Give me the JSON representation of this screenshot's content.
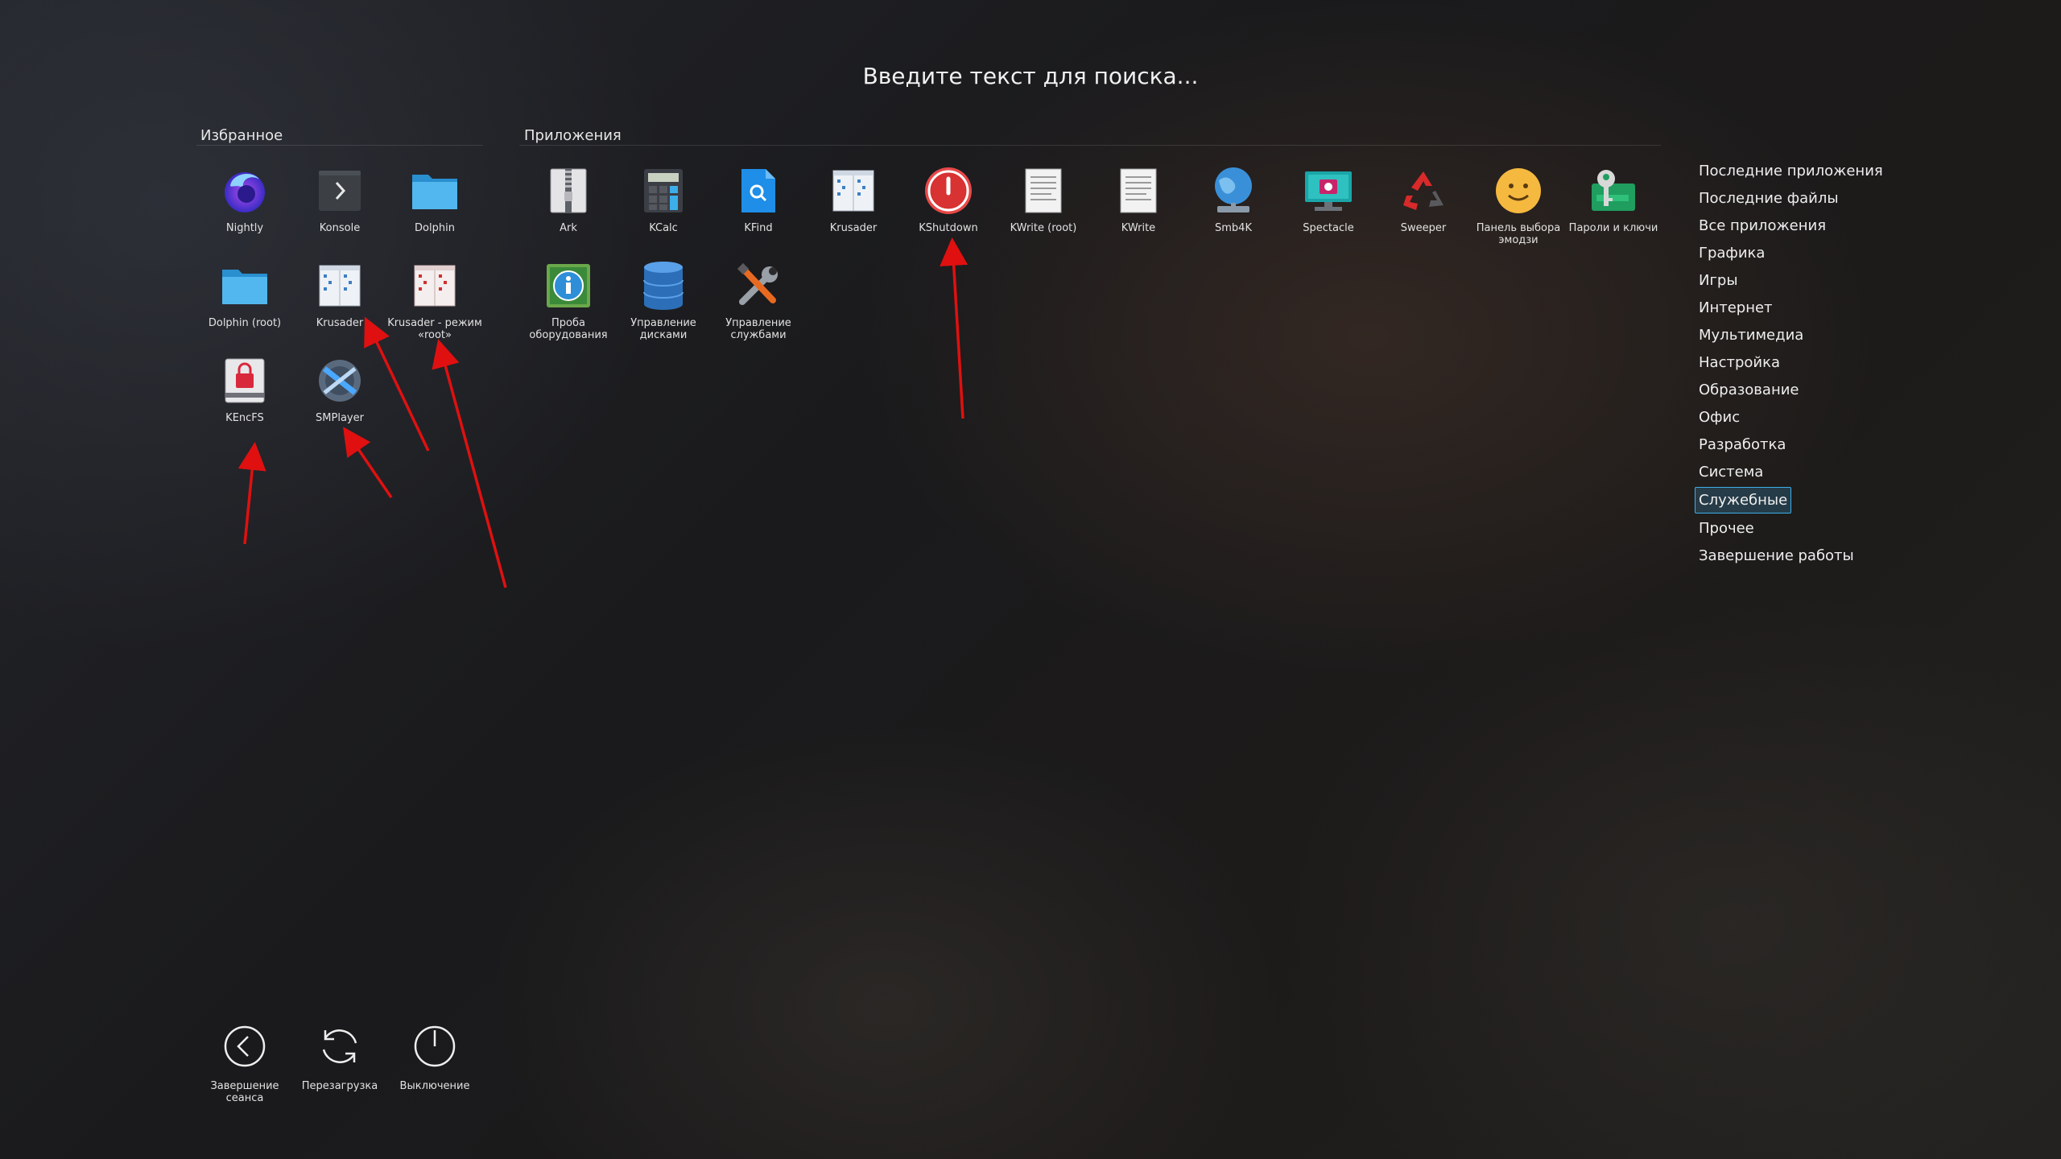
{
  "search": {
    "placeholder": "Введите текст для поиска..."
  },
  "favorites": {
    "title": "Избранное",
    "items": [
      {
        "label": "Nightly",
        "icon": "firefox-nightly-icon"
      },
      {
        "label": "Konsole",
        "icon": "konsole-icon"
      },
      {
        "label": "Dolphin",
        "icon": "dolphin-folder-icon"
      },
      {
        "label": "Dolphin (root)",
        "icon": "dolphin-folder-icon"
      },
      {
        "label": "Krusader",
        "icon": "krusader-icon"
      },
      {
        "label": "Krusader - режим «root»",
        "icon": "krusader-root-icon"
      },
      {
        "label": "KEncFS",
        "icon": "kencfs-lock-icon"
      },
      {
        "label": "SMPlayer",
        "icon": "smplayer-icon"
      }
    ]
  },
  "applications": {
    "title": "Приложения",
    "items": [
      {
        "label": "Ark",
        "icon": "ark-archive-icon"
      },
      {
        "label": "KCalc",
        "icon": "kcalc-icon"
      },
      {
        "label": "KFind",
        "icon": "kfind-icon"
      },
      {
        "label": "Krusader",
        "icon": "krusader-icon"
      },
      {
        "label": "KShutdown",
        "icon": "kshutdown-icon"
      },
      {
        "label": "KWrite (root)",
        "icon": "kwrite-icon"
      },
      {
        "label": "KWrite",
        "icon": "kwrite-icon"
      },
      {
        "label": "Smb4K",
        "icon": "smb4k-globe-icon"
      },
      {
        "label": "Spectacle",
        "icon": "spectacle-icon"
      },
      {
        "label": "Sweeper",
        "icon": "sweeper-icon"
      },
      {
        "label": "Панель выбора эмодзи",
        "icon": "emoji-picker-icon"
      },
      {
        "label": "Пароли и ключи",
        "icon": "passwords-keys-icon"
      },
      {
        "label": "Проба оборудования",
        "icon": "hardware-info-icon"
      },
      {
        "label": "Управление дисками",
        "icon": "disk-manager-icon"
      },
      {
        "label": "Управление службами",
        "icon": "service-manager-icon"
      }
    ]
  },
  "categories": [
    "Последние приложения",
    "Последние файлы",
    "Все приложения",
    "Графика",
    "Игры",
    "Интернет",
    "Мультимедиа",
    "Настройка",
    "Образование",
    "Офис",
    "Разработка",
    "Система",
    "Служебные",
    "Прочее",
    "Завершение работы"
  ],
  "selected_category": "Служебные",
  "power": [
    {
      "label": "Завершение сеанса",
      "icon": "logout-icon"
    },
    {
      "label": "Перезагрузка",
      "icon": "restart-icon"
    },
    {
      "label": "Выключение",
      "icon": "shutdown-icon"
    }
  ],
  "colors": {
    "accent": "#3daee9",
    "annotation": "#e01010"
  }
}
